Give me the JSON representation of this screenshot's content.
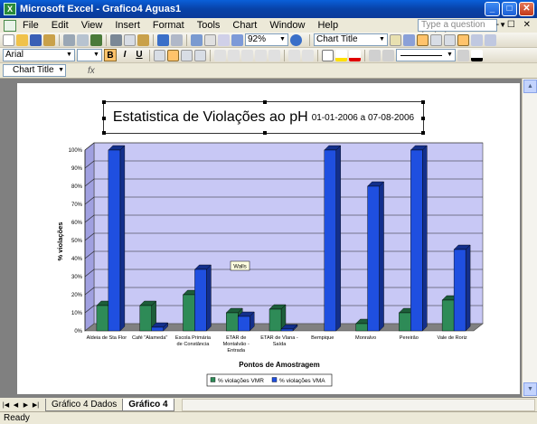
{
  "window": {
    "title": "Microsoft Excel - Grafico4 Aguas1"
  },
  "menu": {
    "items": [
      "File",
      "Edit",
      "View",
      "Insert",
      "Format",
      "Tools",
      "Chart",
      "Window",
      "Help"
    ],
    "help_placeholder": "Type a question for help"
  },
  "toolbar": {
    "zoom": "92%",
    "chart_object": "Chart Title",
    "font_name": "Arial"
  },
  "formula_bar": {
    "name_box": "Chart Title",
    "fx": "fx"
  },
  "sheet_tabs": [
    "Gráfico 4 Dados",
    "Gráfico 4"
  ],
  "status": "Ready",
  "chart_data": {
    "type": "bar",
    "title": "Estatistica de Violações  ao pH",
    "subtitle": "01-01-2006 a 07-08-2006",
    "xlabel": "Pontos de Amostragem",
    "ylabel": "% violações",
    "ylim": [
      0,
      100
    ],
    "yticks": [
      "0%",
      "10%",
      "20%",
      "30%",
      "40%",
      "50%",
      "60%",
      "70%",
      "80%",
      "90%",
      "100%"
    ],
    "categories": [
      [
        "Aldeia de Sta Flor"
      ],
      [
        "Café \"Alameda\""
      ],
      [
        "Escola Primária",
        "de Constância"
      ],
      [
        "ETAR de",
        "Montalvão -",
        "Entrada"
      ],
      [
        "ETAR de Vlana -",
        "Saída"
      ],
      [
        "Bempique"
      ],
      [
        "Monralvo"
      ],
      [
        "Pereirão"
      ],
      [
        "Vale de Roriz"
      ]
    ],
    "series": [
      {
        "name": "% violações VMR",
        "color": "#2e8b57",
        "values": [
          14,
          14,
          20,
          10,
          12,
          0,
          4,
          10,
          17
        ]
      },
      {
        "name": "% violações VMA",
        "color": "#1f4fe0",
        "values": [
          100,
          2,
          34,
          8,
          1,
          100,
          80,
          100,
          45
        ]
      }
    ],
    "tooltip": "Walls",
    "grid": true,
    "legend": "bottom"
  },
  "colors": {
    "plot_bg": "#c8c8f5",
    "floor": "#808080",
    "bar_dark_green": "#1d5e3a",
    "bar_dark_blue": "#132f8c"
  }
}
